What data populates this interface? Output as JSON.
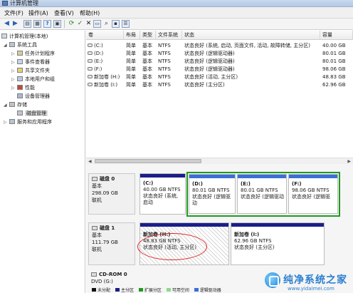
{
  "window": {
    "title": "计算机管理"
  },
  "menu": [
    "文件(F)",
    "操作(A)",
    "查看(V)",
    "帮助(H)"
  ],
  "toolbar_icons": [
    "back-icon",
    "forward-icon",
    "console-tree-icon",
    "properties-icon",
    "help-icon",
    "show-hide-icon",
    "refresh-icon",
    "check-icon",
    "delete-icon",
    "open-icon",
    "search-icon",
    "new-icon",
    "prop-list-icon"
  ],
  "tree": [
    {
      "label": "计算机管理(本地)",
      "level": 0,
      "expanded": true
    },
    {
      "label": "系统工具",
      "level": 1,
      "expanded": true
    },
    {
      "label": "任务计划程序",
      "level": 2,
      "collapsed": true
    },
    {
      "label": "事件查看器",
      "level": 2,
      "collapsed": true
    },
    {
      "label": "共享文件夹",
      "level": 2,
      "collapsed": true
    },
    {
      "label": "本地用户和组",
      "level": 2,
      "collapsed": true
    },
    {
      "label": "性能",
      "level": 2,
      "collapsed": true
    },
    {
      "label": "设备管理器",
      "level": 2
    },
    {
      "label": "存储",
      "level": 1,
      "expanded": true
    },
    {
      "label": "磁盘管理",
      "level": 2,
      "selected": true
    },
    {
      "label": "服务和应用程序",
      "level": 1,
      "collapsed": true
    }
  ],
  "volumes": {
    "headers": [
      "卷",
      "布局",
      "类型",
      "文件系统",
      "状态",
      "容量"
    ],
    "rows": [
      [
        "(C:)",
        "简单",
        "基本",
        "NTFS",
        "状态良好 (系统, 启动, 页面文件, 活动, 故障转储, 主分区)",
        "40.00 GB"
      ],
      [
        "(D:)",
        "简单",
        "基本",
        "NTFS",
        "状态良好 (逻辑驱动器)",
        "80.01 GB"
      ],
      [
        "(E:)",
        "简单",
        "基本",
        "NTFS",
        "状态良好 (逻辑驱动器)",
        "80.01 GB"
      ],
      [
        "(F:)",
        "简单",
        "基本",
        "NTFS",
        "状态良好 (逻辑驱动器)",
        "98.06 GB"
      ],
      [
        "新加卷 (H:)",
        "简单",
        "基本",
        "NTFS",
        "状态良好 (活动, 主分区)",
        "48.83 GB"
      ],
      [
        "新加卷 (I:)",
        "简单",
        "基本",
        "NTFS",
        "状态良好 (主分区)",
        "62.96 GB"
      ]
    ]
  },
  "disks": [
    {
      "name": "磁盘 0",
      "type": "基本",
      "size": "298.09 GB",
      "status": "联机",
      "partitions": [
        {
          "name": "(C:)",
          "size": "40.00 GB NTFS",
          "status": "状态良好 (系统, 启动"
        },
        {
          "name": "(D:)",
          "size": "80.01 GB NTFS",
          "status": "状态良好 (逻辑驱动"
        },
        {
          "name": "(E:)",
          "size": "80.01 GB NTFS",
          "status": "状态良好 (逻辑驱动"
        },
        {
          "name": "(F:)",
          "size": "98.06 GB NTFS",
          "status": "状态良好 (逻辑驱"
        }
      ]
    },
    {
      "name": "磁盘 1",
      "type": "基本",
      "size": "111.79 GB",
      "status": "联机",
      "partitions": [
        {
          "name": "新加卷 (H:)",
          "size": "48.83 GB NTFS",
          "status": "状态良好 (活动, 主分区)"
        },
        {
          "name": "新加卷 (I:)",
          "size": "62.96 GB NTFS",
          "status": "状态良好 (主分区)"
        }
      ]
    },
    {
      "name": "CD-ROM 0",
      "type": "DVD (G:)"
    }
  ],
  "legend": [
    "未分配",
    "主分区",
    "扩展分区",
    "可用空间",
    "逻辑驱动器"
  ],
  "colors": {
    "primary": "#1a1e8a",
    "logical": "#3a6fd8",
    "extended": "#1f9b1f",
    "annotation": "#e02525"
  },
  "watermark": {
    "title": "纯净系统之家",
    "url": "www.yidaimei.com"
  }
}
